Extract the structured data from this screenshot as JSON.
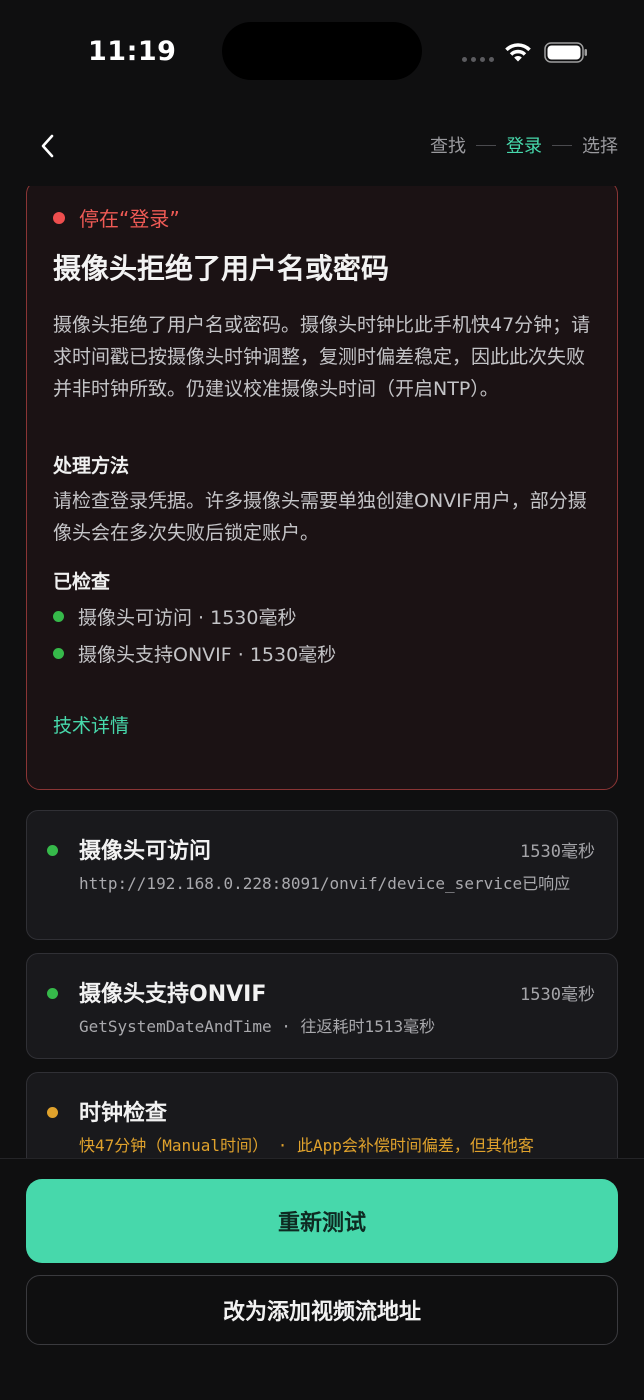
{
  "status_bar": {
    "time": "11:19",
    "icons": [
      "signal-dots-icon",
      "wifi-icon",
      "battery-icon"
    ]
  },
  "header": {
    "back_icon": "chevron-left-icon",
    "steps": [
      {
        "label": "查找",
        "active": false
      },
      {
        "label": "登录",
        "active": true
      },
      {
        "label": "选择",
        "active": false
      }
    ]
  },
  "error_card": {
    "stop_label": "停在“登录”",
    "title": "摄像头拒绝了用户名或密码",
    "description": "摄像头拒绝了用户名或密码。摄像头时钟比此手机快47分钟；请求时间戳已按摄像头时钟调整，复测时偏差稳定，因此此次失败并非时钟所致。仍建议校准摄像头时间（开启NTP）。",
    "howto_heading": "处理方法",
    "howto_text": "请检查登录凭据。许多摄像头需要单独创建ONVIF用户，部分摄像头会在多次失败后锁定账户。",
    "checked_heading": "已检查",
    "checked_items": [
      "摄像头可访问 · 1530毫秒",
      "摄像头支持ONVIF · 1530毫秒"
    ],
    "tech_details_link": "技术详情"
  },
  "step_cards": [
    {
      "title": "摄像头可访问",
      "time": "1530毫秒",
      "detail": "http://192.168.0.228:8091/onvif/device_service已响应",
      "status": "ok"
    },
    {
      "title": "摄像头支持ONVIF",
      "time": "1530毫秒",
      "detail": "GetSystemDateAndTime · 往返耗时1513毫秒",
      "status": "ok"
    },
    {
      "title": "时钟检查",
      "time": "",
      "detail": "快47分钟（Manual时间） · 此App会补偿时间偏差，但其他客",
      "status": "warn"
    }
  ],
  "buttons": {
    "retest": "重新测试",
    "add_stream": "改为添加视频流地址"
  },
  "colors": {
    "accent": "#47d8ab",
    "error": "#ee4e4e",
    "ok": "#36b94a",
    "warn": "#e0a22c",
    "background": "#0f0f10"
  }
}
